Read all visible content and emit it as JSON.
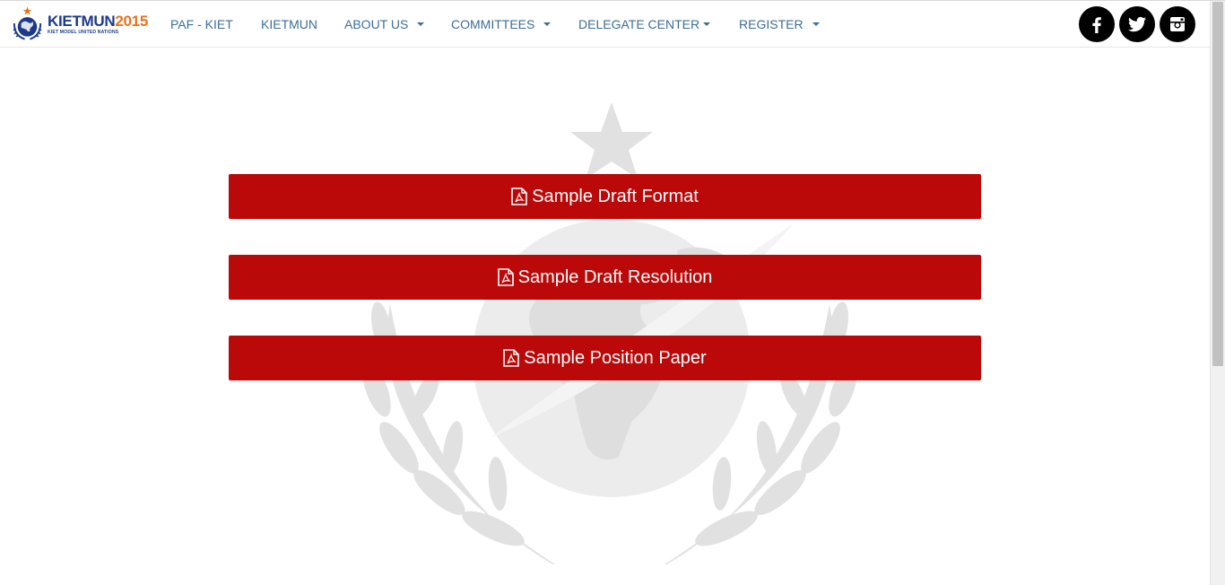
{
  "brand": {
    "name_part1": "KIETMUN",
    "name_part2": "2015",
    "tagline": "KIET MODEL UNITED NATIONS",
    "icon": "un-emblem-logo",
    "colors": {
      "primary": "#1d3a8a",
      "accent": "#e8731c"
    }
  },
  "nav": {
    "items": [
      {
        "label": "PAF - KIET",
        "dropdown": false
      },
      {
        "label": "KIETMUN",
        "dropdown": false
      },
      {
        "label": "ABOUT US",
        "dropdown": true
      },
      {
        "label": "COMMITTEES",
        "dropdown": true
      },
      {
        "label": "DELEGATE CENTER",
        "dropdown": true
      },
      {
        "label": "REGISTER",
        "dropdown": true
      }
    ],
    "link_color": "#3d6e98"
  },
  "social": [
    {
      "name": "facebook",
      "icon": "facebook-icon"
    },
    {
      "name": "twitter",
      "icon": "twitter-icon"
    },
    {
      "name": "instagram",
      "icon": "instagram-icon"
    }
  ],
  "documents": {
    "button_color": "#bb0808",
    "icon": "file-pdf-icon",
    "items": [
      {
        "label": "Sample Draft Format"
      },
      {
        "label": "Sample Draft Resolution"
      },
      {
        "label": "Sample Position Paper"
      }
    ]
  },
  "background": {
    "watermark": "un-emblem-watermark"
  }
}
